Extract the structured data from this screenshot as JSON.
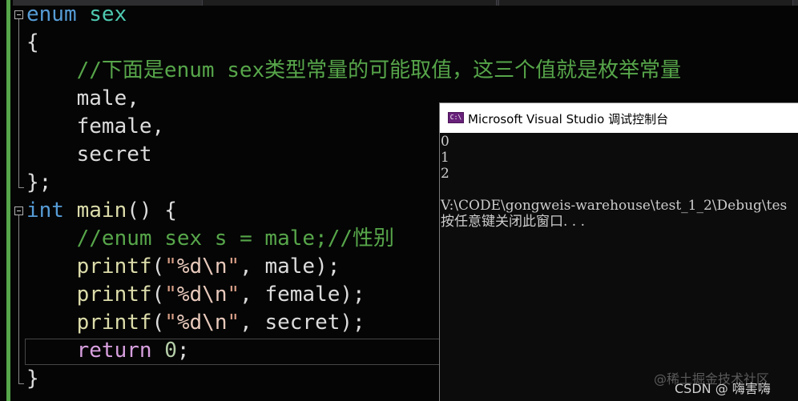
{
  "editor": {
    "lines": [
      [
        {
          "t": "enum",
          "c": "kw"
        },
        {
          "t": " ",
          "c": "plain"
        },
        {
          "t": "sex",
          "c": "ident"
        }
      ],
      [
        {
          "t": "{",
          "c": "plain"
        }
      ],
      [
        {
          "t": "    ",
          "c": "plain"
        },
        {
          "t": "//下面是enum sex类型常量的可能取值，这三个值就是枚举常量",
          "c": "comment"
        }
      ],
      [
        {
          "t": "    ",
          "c": "plain"
        },
        {
          "t": "male",
          "c": "enumval"
        },
        {
          "t": ",",
          "c": "plain"
        }
      ],
      [
        {
          "t": "    ",
          "c": "plain"
        },
        {
          "t": "female",
          "c": "enumval"
        },
        {
          "t": ",",
          "c": "plain"
        }
      ],
      [
        {
          "t": "    ",
          "c": "plain"
        },
        {
          "t": "secret",
          "c": "enumval"
        }
      ],
      [
        {
          "t": "};",
          "c": "plain"
        }
      ],
      [
        {
          "t": "int",
          "c": "kw"
        },
        {
          "t": " ",
          "c": "plain"
        },
        {
          "t": "main",
          "c": "func"
        },
        {
          "t": "() {",
          "c": "plain"
        }
      ],
      [
        {
          "t": "    ",
          "c": "plain"
        },
        {
          "t": "//enum sex s = male;//性别",
          "c": "comment"
        }
      ],
      [
        {
          "t": "    ",
          "c": "plain"
        },
        {
          "t": "printf",
          "c": "func"
        },
        {
          "t": "(",
          "c": "plain"
        },
        {
          "t": "\"",
          "c": "str"
        },
        {
          "t": "%d\\n",
          "c": "esc"
        },
        {
          "t": "\"",
          "c": "str"
        },
        {
          "t": ", ",
          "c": "plain"
        },
        {
          "t": "male",
          "c": "enumval"
        },
        {
          "t": ");",
          "c": "plain"
        }
      ],
      [
        {
          "t": "    ",
          "c": "plain"
        },
        {
          "t": "printf",
          "c": "func"
        },
        {
          "t": "(",
          "c": "plain"
        },
        {
          "t": "\"",
          "c": "str"
        },
        {
          "t": "%d\\n",
          "c": "esc"
        },
        {
          "t": "\"",
          "c": "str"
        },
        {
          "t": ", ",
          "c": "plain"
        },
        {
          "t": "female",
          "c": "enumval"
        },
        {
          "t": ");",
          "c": "plain"
        }
      ],
      [
        {
          "t": "    ",
          "c": "plain"
        },
        {
          "t": "printf",
          "c": "func"
        },
        {
          "t": "(",
          "c": "plain"
        },
        {
          "t": "\"",
          "c": "str"
        },
        {
          "t": "%d\\n",
          "c": "esc"
        },
        {
          "t": "\"",
          "c": "str"
        },
        {
          "t": ", ",
          "c": "plain"
        },
        {
          "t": "secret",
          "c": "enumval"
        },
        {
          "t": ");",
          "c": "plain"
        }
      ],
      [
        {
          "t": "    ",
          "c": "plain"
        },
        {
          "t": "return",
          "c": "ctrl"
        },
        {
          "t": " ",
          "c": "plain"
        },
        {
          "t": "0",
          "c": "num"
        },
        {
          "t": ";",
          "c": "plain"
        }
      ],
      [
        {
          "t": "}",
          "c": "plain"
        }
      ]
    ]
  },
  "console": {
    "title": "Microsoft Visual Studio 调试控制台",
    "icon": "console-app-icon",
    "icon_label": "C:\\",
    "lines": [
      "0",
      "1",
      "2",
      "",
      "V:\\CODE\\gongweis-warehouse\\test_1_2\\Debug\\tes",
      "按任意键关闭此窗口. . ."
    ]
  },
  "watermarks": {
    "juejin": "@稀土掘金技术社区",
    "csdn": "CSDN @    嗨害嗨"
  },
  "colors": {
    "keyword": "#569cd6",
    "type_name": "#4ec9b0",
    "comment": "#57a64a",
    "function": "#dcdcaa",
    "string": "#d69d85",
    "number": "#b5cea8",
    "control": "#d8a0df",
    "console_accent": "#68217a"
  }
}
